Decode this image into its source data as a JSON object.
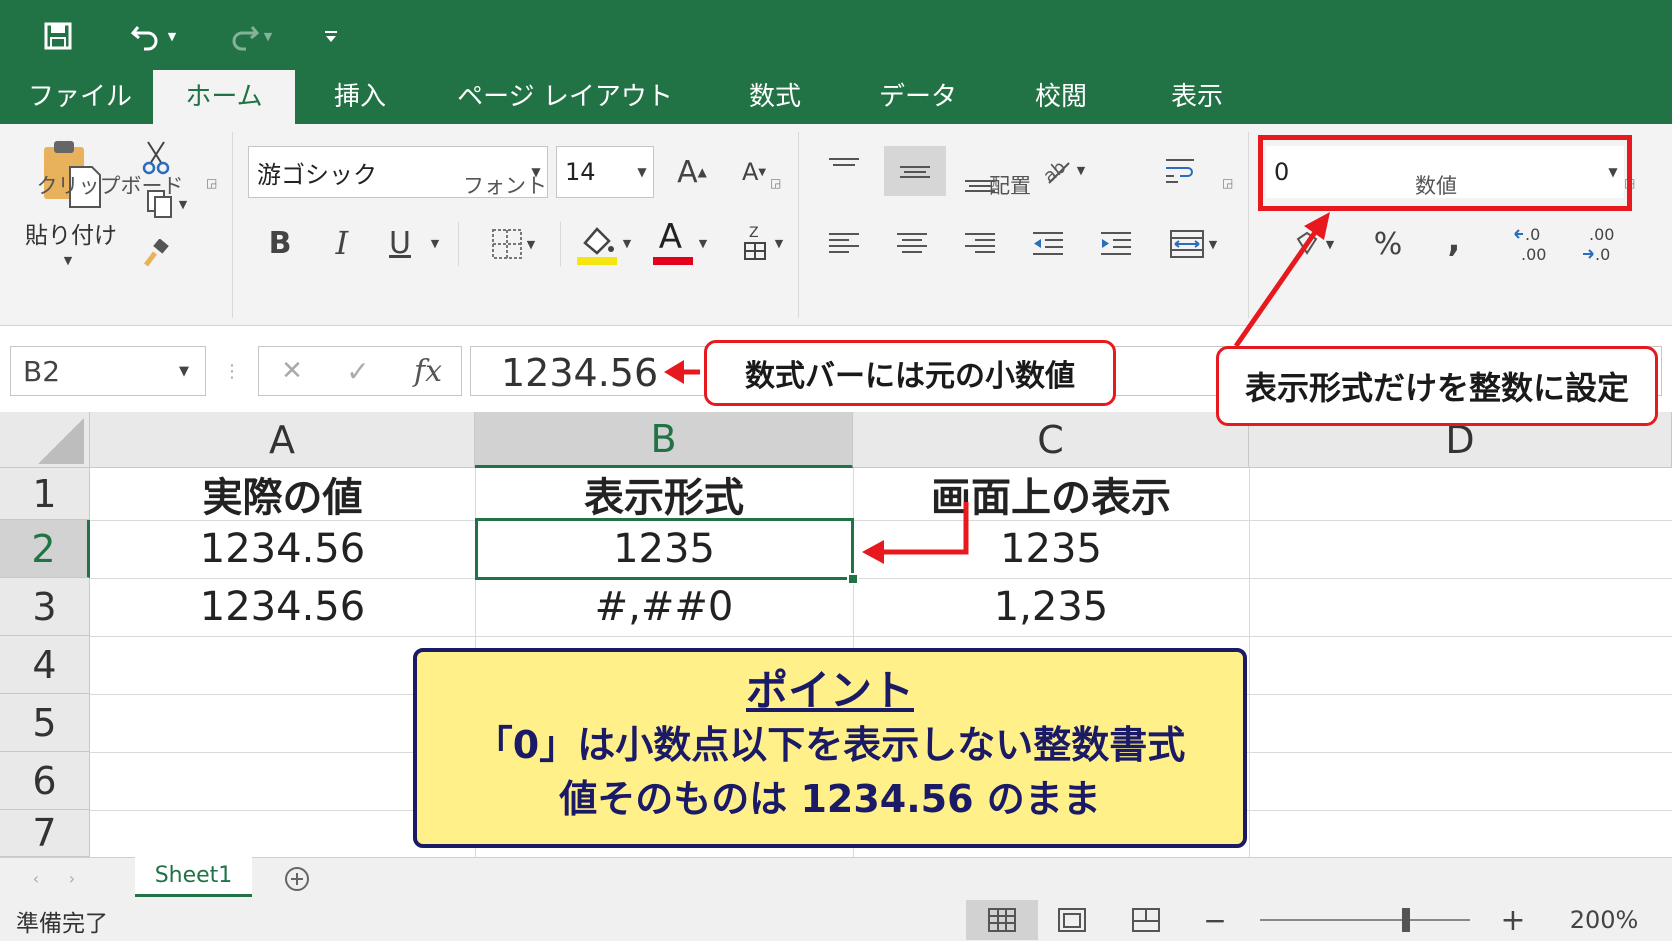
{
  "tabs": [
    "ファイル",
    "ホーム",
    "挿入",
    "ページ レイアウト",
    "数式",
    "データ",
    "校閲",
    "表示"
  ],
  "ribbon": {
    "clipboard": {
      "paste_label": "貼り付け",
      "group_label": "クリップボード"
    },
    "font": {
      "name": "游ゴシック",
      "size": "14",
      "group_label": "フォント",
      "bold": "B",
      "italic": "I",
      "underline": "U",
      "grow": "A",
      "shrink": "A",
      "color_letter": "A"
    },
    "alignment": {
      "group_label": "配置"
    },
    "number": {
      "format": "0",
      "group_label": "数値",
      "percent": "%",
      "comma": ","
    }
  },
  "colors": {
    "accent": "#217346",
    "callout_red": "#e8191e",
    "point_bg": "#fff089",
    "point_border": "#1a1a66"
  },
  "formula_bar": {
    "name_box": "B2",
    "fx": "fx",
    "cancel": "✕",
    "enter": "✓",
    "value": "1234.56"
  },
  "grid": {
    "columns": [
      "A",
      "B",
      "C",
      "D"
    ],
    "rows": [
      "1",
      "2",
      "3",
      "4",
      "5",
      "6",
      "7"
    ],
    "cells": [
      [
        "実際の値",
        "表示形式",
        "画面上の表示"
      ],
      [
        "1234.56",
        "1235",
        "1235"
      ],
      [
        "1234.56",
        "#,##0",
        "1,235"
      ]
    ],
    "selected_cell": "B2"
  },
  "callouts": {
    "formula": "数式バーには元の小数値",
    "format": "表示形式だけを整数に設定"
  },
  "point": {
    "title": "ポイント",
    "line1": "「0」は小数点以下を表示しない整数書式",
    "line2": "値そのものは 1234.56 のまま"
  },
  "sheets": [
    "Sheet1"
  ],
  "status": {
    "ready": "準備完了",
    "zoom": "200%",
    "minus": "−",
    "plus": "+"
  }
}
